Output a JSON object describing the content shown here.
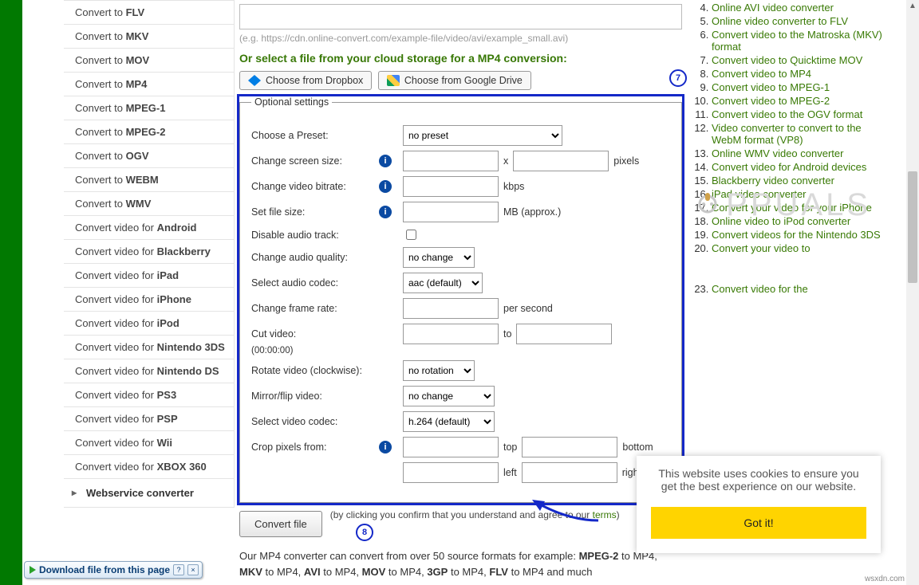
{
  "leftnav": {
    "items": [
      {
        "prefix": "Convert to ",
        "target": "FLV"
      },
      {
        "prefix": "Convert to ",
        "target": "MKV"
      },
      {
        "prefix": "Convert to ",
        "target": "MOV"
      },
      {
        "prefix": "Convert to ",
        "target": "MP4"
      },
      {
        "prefix": "Convert to ",
        "target": "MPEG-1"
      },
      {
        "prefix": "Convert to ",
        "target": "MPEG-2"
      },
      {
        "prefix": "Convert to ",
        "target": "OGV"
      },
      {
        "prefix": "Convert to ",
        "target": "WEBM"
      },
      {
        "prefix": "Convert to ",
        "target": "WMV"
      },
      {
        "prefix": "Convert video for ",
        "target": "Android"
      },
      {
        "prefix": "Convert video for ",
        "target": "Blackberry"
      },
      {
        "prefix": "Convert video for ",
        "target": "iPad"
      },
      {
        "prefix": "Convert video for ",
        "target": "iPhone"
      },
      {
        "prefix": "Convert video for ",
        "target": "iPod"
      },
      {
        "prefix": "Convert video for ",
        "target": "Nintendo 3DS"
      },
      {
        "prefix": "Convert video for ",
        "target": "Nintendo DS"
      },
      {
        "prefix": "Convert video for ",
        "target": "PS3"
      },
      {
        "prefix": "Convert video for ",
        "target": "PSP"
      },
      {
        "prefix": "Convert video for ",
        "target": "Wii"
      },
      {
        "prefix": "Convert video for ",
        "target": "XBOX 360"
      }
    ],
    "footer": "Webservice converter"
  },
  "main": {
    "url_hint": "(e.g. https://cdn.online-convert.com/example-file/video/avi/example_small.avi)",
    "cloud_title": "Or select a file from your cloud storage for a MP4 conversion:",
    "dropbox_label": "Choose from Dropbox",
    "gdrive_label": "Choose from Google Drive",
    "step7": "7",
    "step8": "8",
    "fieldset_legend": "Optional settings",
    "labels": {
      "preset": "Choose a Preset:",
      "screen": "Change screen size:",
      "bitrate": "Change video bitrate:",
      "filesize": "Set file size:",
      "disable_audio": "Disable audio track:",
      "audio_quality": "Change audio quality:",
      "audio_codec": "Select audio codec:",
      "frame_rate": "Change frame rate:",
      "cut": "Cut video:",
      "cut_hint": "(00:00:00)",
      "rotate": "Rotate video (clockwise):",
      "mirror": "Mirror/flip video:",
      "video_codec": "Select video codec:",
      "crop": "Crop pixels from:"
    },
    "units": {
      "x": "x",
      "pixels": "pixels",
      "kbps": "kbps",
      "mb": "MB (approx.)",
      "fps": "per second",
      "to": "to",
      "top": "top",
      "bottom": "bottom",
      "left": "left",
      "right": "right"
    },
    "selects": {
      "preset": "no preset",
      "audio_quality": "no change",
      "audio_codec": "aac (default)",
      "rotate": "no rotation",
      "mirror": "no change",
      "video_codec": "h.264 (default)"
    },
    "convert_btn": "Convert file",
    "agree_pre": "(by clicking you confirm that you understand and agree to our ",
    "agree_link": "terms",
    "agree_post": ")",
    "desc_1": "Our MP4 converter can convert from over 50 source formats for example: ",
    "desc_fmts": [
      "MPEG-2",
      "MKV",
      "AVI",
      "MOV",
      "3GP",
      "FLV"
    ],
    "desc_to": " to MP4, ",
    "desc_tail": " to MP4 and much"
  },
  "rightnav": {
    "start": 4,
    "items": [
      "Online AVI video converter",
      "Online video converter to FLV",
      "Convert video to the Matroska (MKV) format",
      "Convert video to Quicktime MOV",
      "Convert video to MP4",
      "Convert video to MPEG-1",
      "Convert video to MPEG-2",
      "Convert video to the OGV format",
      "Video converter to convert to the WebM format (VP8)",
      "Online WMV video converter",
      "Convert video for Android devices",
      "Blackberry video converter",
      "iPad video converter",
      "Convert your video for your iPhone",
      "Online video to iPod converter",
      "Convert videos for the Nintendo 3DS",
      "Convert your video to",
      "",
      "",
      "Convert video for the"
    ]
  },
  "cookie": {
    "msg": "This website uses cookies to ensure you get the best experience on our website.",
    "btn": "Got it!"
  },
  "watermark": "PPUALS",
  "download_bar": "Download file from this page",
  "wsx": "wsxdn.com"
}
